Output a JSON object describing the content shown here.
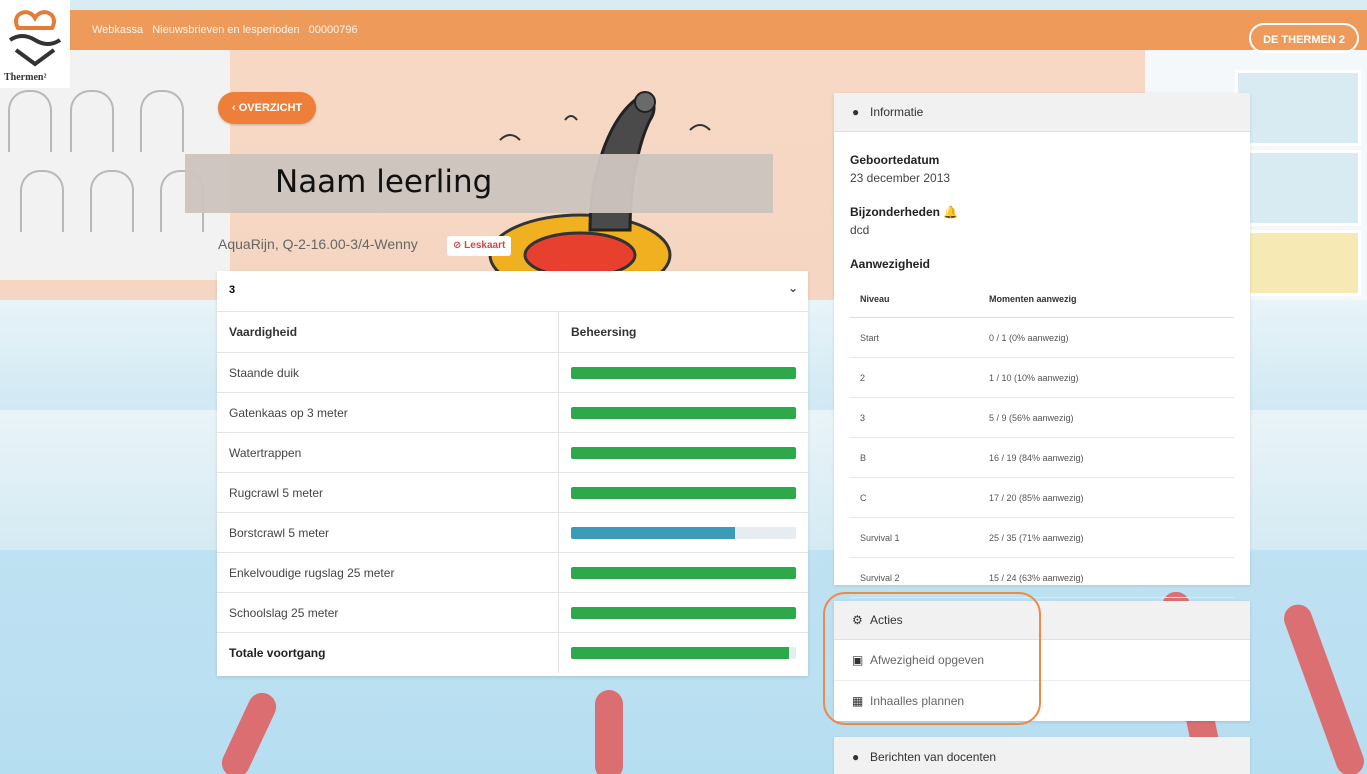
{
  "topbar": {
    "crumbs": [
      "Webkassa",
      "Nieuwsbrieven en lesperioden",
      "00000796"
    ],
    "logo_text": "Thermen²",
    "right_button": "DE THERMEN 2"
  },
  "back_button": "‹  OVERZICHT",
  "student": {
    "name": "Naam leerling",
    "subinfo": "AquaRijn, Q-2-16.00-3/4-Wenny",
    "leskaart": "Leskaart"
  },
  "skills_card": {
    "level": "3",
    "col_skill": "Vaardigheid",
    "col_mastery": "Beheersing",
    "rows": [
      {
        "name": "Staande duik",
        "progress": 1.0,
        "color": "#2ea84a"
      },
      {
        "name": "Gatenkaas op 3 meter",
        "progress": 1.0,
        "color": "#2ea84a"
      },
      {
        "name": "Watertrappen",
        "progress": 1.0,
        "color": "#2ea84a"
      },
      {
        "name": "Rugcrawl 5 meter",
        "progress": 1.0,
        "color": "#2ea84a"
      },
      {
        "name": "Borstcrawl 5 meter",
        "progress": 0.73,
        "color": "#3a9cb8"
      },
      {
        "name": "Enkelvoudige rugslag 25 meter",
        "progress": 1.0,
        "color": "#2ea84a"
      },
      {
        "name": "Schoolslag 25 meter",
        "progress": 1.0,
        "color": "#2ea84a"
      }
    ],
    "total_label": "Totale voortgang",
    "total_progress": 0.97,
    "total_color": "#2ea84a"
  },
  "info": {
    "header": "Informatie",
    "dob_label": "Geboortedatum",
    "dob_value": "23 december 2013",
    "special_label": "Bijzonderheden",
    "special_value": "dcd",
    "attendance_label": "Aanwezigheid",
    "att_col_level": "Niveau",
    "att_col_moments": "Momenten aanwezig",
    "attendance": [
      {
        "level": "Start",
        "moments": "0 / 1 (0% aanwezig)"
      },
      {
        "level": "2",
        "moments": "1 / 10 (10% aanwezig)"
      },
      {
        "level": "3",
        "moments": "5 / 9 (56% aanwezig)"
      },
      {
        "level": "B",
        "moments": "16 / 19 (84% aanwezig)"
      },
      {
        "level": "C",
        "moments": "17 / 20 (85% aanwezig)"
      },
      {
        "level": "Survival 1",
        "moments": "25 / 35 (71% aanwezig)"
      },
      {
        "level": "Survival 2",
        "moments": "15 / 24 (63% aanwezig)"
      }
    ]
  },
  "acties": {
    "header": "Acties",
    "items": [
      "Afwezigheid opgeven",
      "Inhaalles plannen"
    ]
  },
  "berichten": {
    "header": "Berichten van docenten"
  },
  "colors": {
    "topbar": "#ee9a5b",
    "accent": "#ee7f3b",
    "highlight": "#ee8a45"
  }
}
